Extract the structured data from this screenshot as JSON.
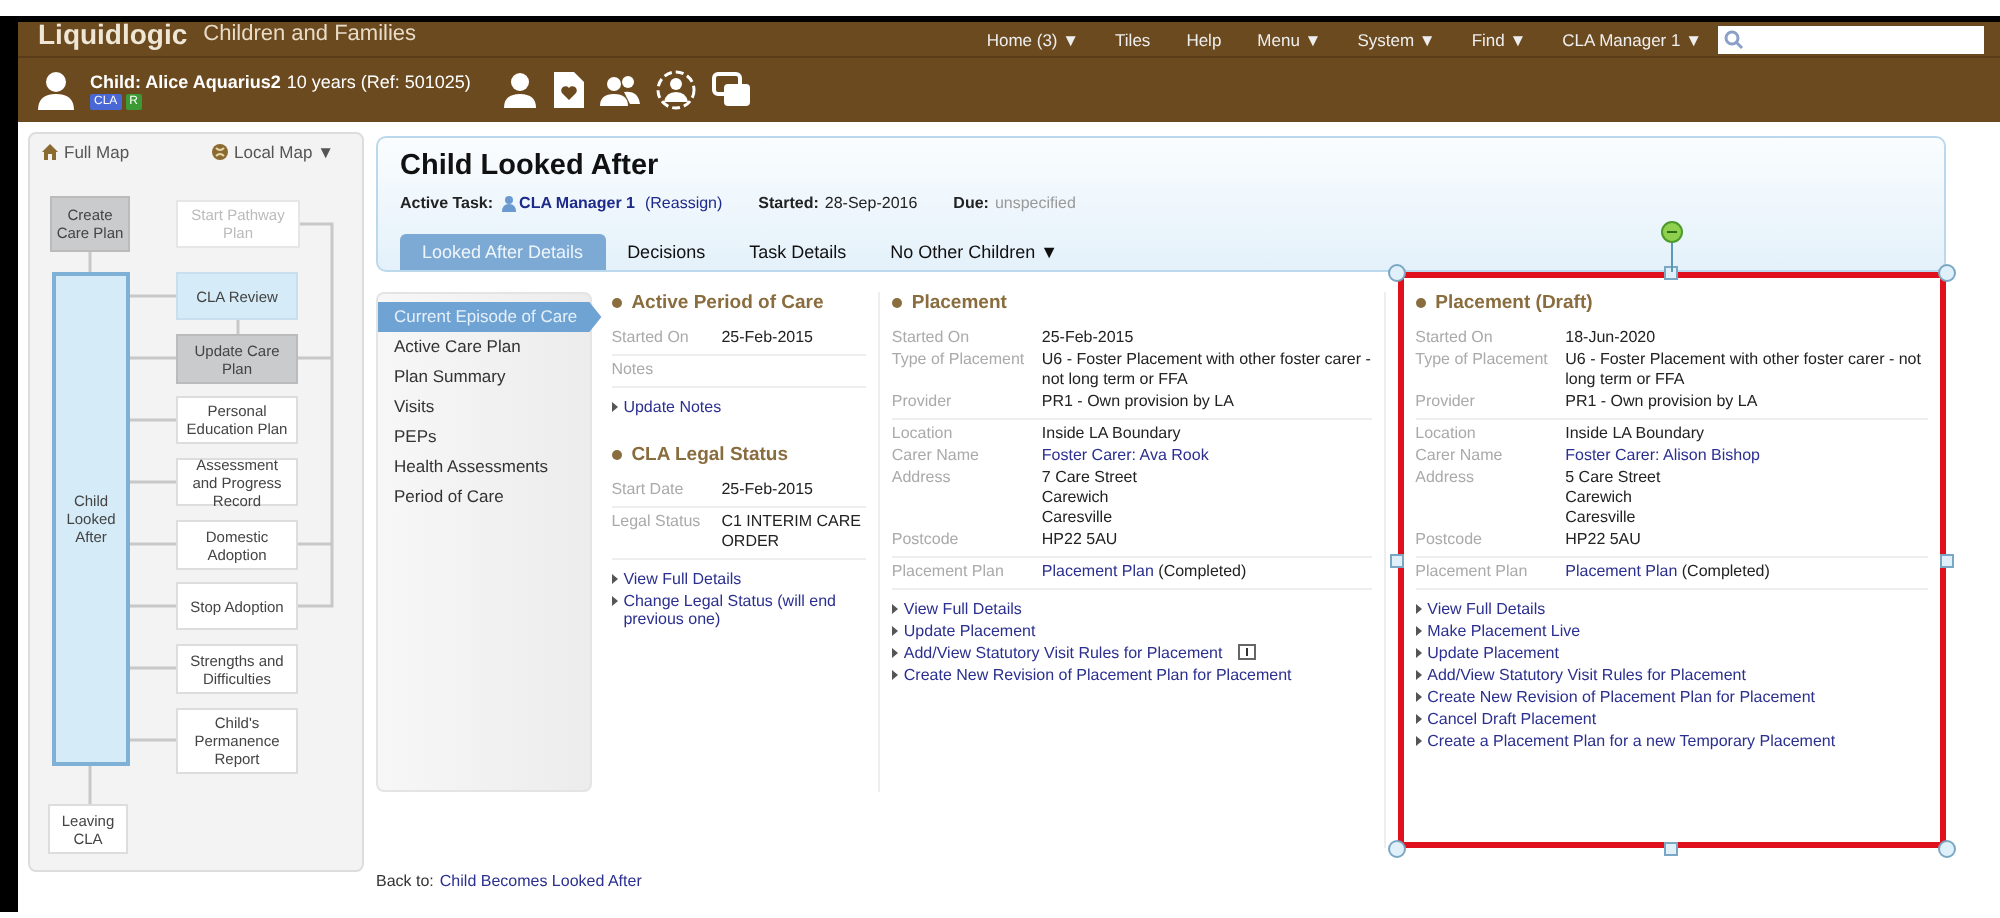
{
  "app_bar": {
    "title": "Liquidlogic",
    "subtitle": "Children and Families",
    "menu": [
      {
        "label": "Home (3) ▼"
      },
      {
        "label": "Tiles"
      },
      {
        "label": "Help"
      },
      {
        "label": "Menu ▼"
      },
      {
        "label": "System ▼"
      },
      {
        "label": "Find ▼"
      },
      {
        "label": "CLA Manager 1 ▼"
      }
    ]
  },
  "child_bar": {
    "name": "Child: Alice Aquarius2",
    "details": "10 years (Ref: 501025)",
    "badges": [
      {
        "label": "CLA",
        "color": "#4a67d6"
      },
      {
        "label": "R",
        "color": "#3c9a35"
      }
    ]
  },
  "map": {
    "links": [
      {
        "label": "Full Map"
      },
      {
        "label": "Local Map ▼"
      }
    ],
    "nodes": [
      {
        "label": "Create Care Plan",
        "kind": "done"
      },
      {
        "label": "Child Looked After",
        "kind": "current"
      },
      {
        "label": "Leaving CLA",
        "kind": "available"
      },
      {
        "label": "Start Pathway Plan",
        "kind": "unavailable"
      },
      {
        "label": "CLA Review",
        "kind": "active"
      },
      {
        "label": "Update Care Plan",
        "kind": "done"
      },
      {
        "label": "Personal Education Plan",
        "kind": "available"
      },
      {
        "label": "Assessment and Progress Record",
        "kind": "available"
      },
      {
        "label": "Domestic Adoption",
        "kind": "available"
      },
      {
        "label": "Stop Adoption",
        "kind": "available"
      },
      {
        "label": "Strengths and Difficulties",
        "kind": "available"
      },
      {
        "label": "Child's Permanence Report",
        "kind": "available"
      }
    ]
  },
  "task": {
    "title": "Child Looked After",
    "active_task_label": "Active Task:",
    "assignee": "CLA Manager 1",
    "reassign": "(Reassign)",
    "started_label": "Started:",
    "started": "28-Sep-2016",
    "due_label": "Due:",
    "due": "unspecified",
    "tabs": [
      {
        "label": "Looked After Details",
        "selected": true
      },
      {
        "label": "Decisions",
        "selected": false
      },
      {
        "label": "Task Details",
        "selected": false
      },
      {
        "label": "No Other Children ▼",
        "selected": false
      }
    ]
  },
  "side_nav": [
    {
      "label": "Current Episode of Care",
      "selected": true
    },
    {
      "label": "Active Care Plan",
      "selected": false
    },
    {
      "label": "Plan Summary",
      "selected": false
    },
    {
      "label": "Visits",
      "selected": false
    },
    {
      "label": "PEPs",
      "selected": false
    },
    {
      "label": "Health Assessments",
      "selected": false
    },
    {
      "label": "Period of Care",
      "selected": false
    }
  ],
  "sections": [
    {
      "title": "Active Period of Care",
      "groups": [
        [
          {
            "label": "Started On",
            "value": "25-Feb-2015"
          }
        ],
        [
          {
            "label": "Notes"
          }
        ]
      ],
      "links": [
        {
          "label": "Update Notes",
          "info": false
        }
      ]
    },
    {
      "title": "CLA Legal Status",
      "groups": [
        [
          {
            "label": "Start Date",
            "value": "25-Feb-2015"
          }
        ],
        [
          {
            "label": "Legal Status",
            "value": "C1 INTERIM CARE ORDER"
          }
        ]
      ],
      "links": [
        {
          "label": "View Full Details",
          "info": false
        },
        {
          "label": "Change Legal Status (will end previous one)",
          "info": false
        }
      ]
    }
  ],
  "placements": [
    {
      "title": "Placement",
      "selected": false,
      "groups": [
        [
          {
            "label": "Started On",
            "value": "25-Feb-2015"
          },
          {
            "label": "Type of Placement",
            "value": "U6 - Foster Placement with other foster carer - not long term or FFA"
          },
          {
            "label": "Provider",
            "value": "PR1 - Own provision by LA"
          }
        ],
        [
          {
            "label": "Location",
            "value": "Inside LA Boundary"
          },
          {
            "label": "Carer Name",
            "link": "Foster Carer: Ava Rook"
          },
          {
            "label": "Address",
            "value": "7 Care Street\nCarewich\nCaresville"
          },
          {
            "label": "Postcode",
            "value": "HP22 5AU"
          }
        ],
        [
          {
            "label": "Placement Plan",
            "link": "Placement Plan",
            "value": "(Completed)"
          }
        ]
      ],
      "links": [
        {
          "label": "View Full Details",
          "info": false
        },
        {
          "label": "Update Placement",
          "info": false
        },
        {
          "label": "Add/View Statutory Visit Rules for Placement",
          "info": true
        },
        {
          "label": "Create New Revision of Placement Plan for Placement",
          "info": false
        }
      ]
    },
    {
      "title": "Placement (Draft)",
      "selected": true,
      "groups": [
        [
          {
            "label": "Started On",
            "value": "18-Jun-2020"
          },
          {
            "label": "Type of Placement",
            "value": "U6 - Foster Placement with other foster carer - not long term or FFA"
          },
          {
            "label": "Provider",
            "value": "PR1 - Own provision by LA"
          }
        ],
        [
          {
            "label": "Location",
            "value": "Inside LA Boundary"
          },
          {
            "label": "Carer Name",
            "link": "Foster Carer: Alison Bishop"
          },
          {
            "label": "Address",
            "value": "5 Care Street\nCarewich\nCaresville"
          },
          {
            "label": "Postcode",
            "value": "HP22 5AU"
          }
        ],
        [
          {
            "label": "Placement Plan",
            "link": "Placement Plan",
            "value": "(Completed)"
          }
        ]
      ],
      "links": [
        {
          "label": "View Full Details",
          "info": false
        },
        {
          "label": "Make Placement Live",
          "info": false
        },
        {
          "label": "Update Placement",
          "info": false
        },
        {
          "label": "Add/View Statutory Visit Rules for Placement",
          "info": false
        },
        {
          "label": "Create New Revision of Placement Plan for Placement",
          "info": false
        },
        {
          "label": "Cancel Draft Placement",
          "info": false
        },
        {
          "label": "Create a Placement Plan for a new Temporary Placement",
          "info": false
        }
      ]
    }
  ],
  "back": {
    "label": "Back to:",
    "link": "Child Becomes Looked After"
  }
}
